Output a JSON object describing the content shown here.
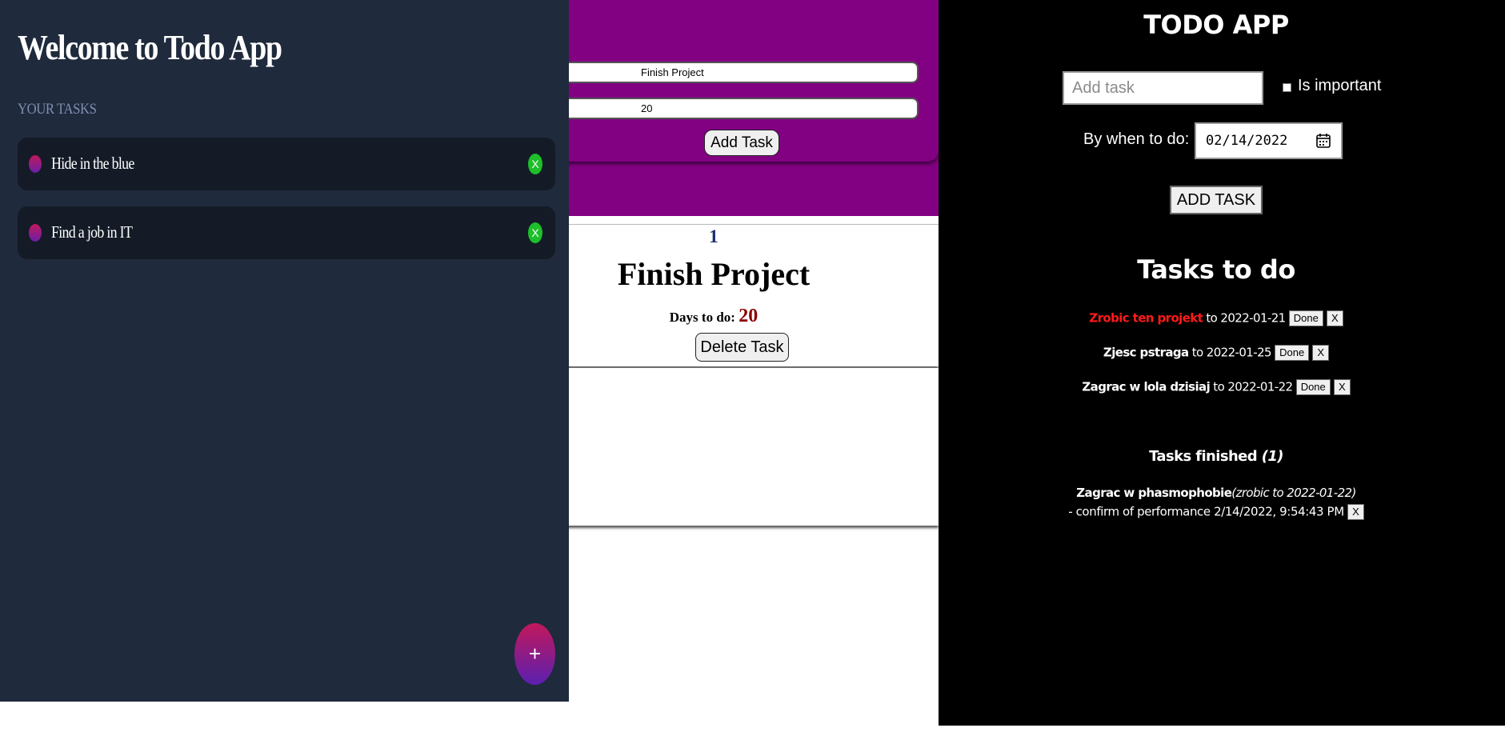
{
  "left_app": {
    "title": "Welcome to Todo App",
    "section_label": "YOUR TASKS",
    "tasks": [
      {
        "label": "Hide in the blue",
        "delete_label": "X"
      },
      {
        "label": "Find a job in IT",
        "delete_label": "X"
      }
    ],
    "add_button_label": "+"
  },
  "middle_app": {
    "task_name_value": "Finish Project",
    "days_value": "20",
    "add_button_label": "Add Task",
    "card": {
      "index": "1",
      "title": "Finish Project",
      "days_label": "Days to do:",
      "days_value": "20",
      "delete_button_label": "Delete Task"
    }
  },
  "right_app": {
    "title": "TODO APP",
    "add_input_placeholder": "Add task",
    "important_label": "Is important",
    "when_label": "By when to do:",
    "date_value": "02/14/2022",
    "add_button_label": "ADD TASK",
    "todo_heading": "Tasks to do",
    "tasks": [
      {
        "name": "Zrobic ten projekt",
        "important": true,
        "to_word": "to",
        "date": "2022-01-21",
        "done_label": "Done",
        "delete_label": "X"
      },
      {
        "name": "Zjesc pstraga",
        "important": false,
        "to_word": "to",
        "date": "2022-01-25",
        "done_label": "Done",
        "delete_label": "X"
      },
      {
        "name": "Zagrac w lola dzisiaj",
        "important": false,
        "to_word": "to",
        "date": "2022-01-22",
        "done_label": "Done",
        "delete_label": "X"
      }
    ],
    "finished_heading": "Tasks finished",
    "finished_count": "(1)",
    "finished_tasks": [
      {
        "name": "Zagrac w phasmophobie",
        "due_note": "(zrobic to 2022-01-22)",
        "confirmation": "- confirm of performance 2/14/2022, 9:54:43 PM",
        "delete_label": "X"
      }
    ],
    "colors": {
      "important": "#ff1a1a",
      "background": "#000000"
    }
  },
  "colors": {
    "left_background": "#1f2a3c",
    "left_card": "#141b27",
    "middle_purple": "#820082",
    "delete_green": "#1dbf2a"
  }
}
